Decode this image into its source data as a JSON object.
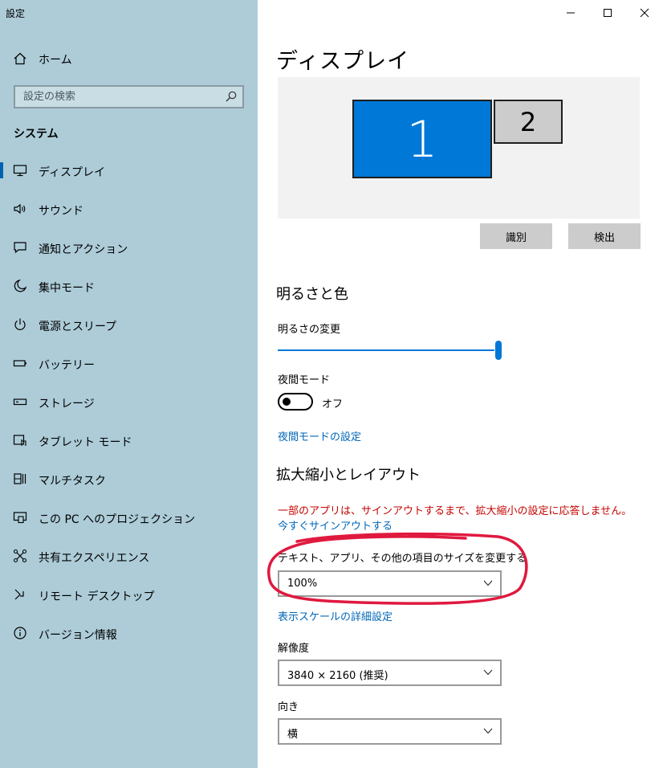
{
  "window": {
    "title": "設定"
  },
  "sidebar": {
    "home_label": "ホーム",
    "search_placeholder": "設定の検索",
    "section_label": "システム",
    "items": [
      {
        "label": "ディスプレイ",
        "icon": "monitor-icon",
        "active": true
      },
      {
        "label": "サウンド",
        "icon": "speaker-icon",
        "active": false
      },
      {
        "label": "通知とアクション",
        "icon": "message-icon",
        "active": false
      },
      {
        "label": "集中モード",
        "icon": "moon-icon",
        "active": false
      },
      {
        "label": "電源とスリープ",
        "icon": "power-icon",
        "active": false
      },
      {
        "label": "バッテリー",
        "icon": "battery-icon",
        "active": false
      },
      {
        "label": "ストレージ",
        "icon": "storage-icon",
        "active": false
      },
      {
        "label": "タブレット モード",
        "icon": "tablet-icon",
        "active": false
      },
      {
        "label": "マルチタスク",
        "icon": "multitask-icon",
        "active": false
      },
      {
        "label": "この PC へのプロジェクション",
        "icon": "projection-icon",
        "active": false
      },
      {
        "label": "共有エクスペリエンス",
        "icon": "shared-icon",
        "active": false
      },
      {
        "label": "リモート デスクトップ",
        "icon": "remote-desktop-icon",
        "active": false
      },
      {
        "label": "バージョン情報",
        "icon": "info-icon",
        "active": false
      }
    ]
  },
  "main": {
    "title": "ディスプレイ",
    "monitors": [
      "1",
      "2"
    ],
    "identify_label": "識別",
    "detect_label": "検出",
    "brightness_section": "明るさと色",
    "brightness_label": "明るさの変更",
    "brightness_value": 100,
    "night_mode_label": "夜間モード",
    "night_mode_state": "オフ",
    "night_mode_settings_link": "夜間モードの設定",
    "scale_section": "拡大縮小とレイアウト",
    "scale_warning": "一部のアプリは、サインアウトするまで、拡大縮小の設定に応答しません。",
    "sign_out_link": "今すぐサインアウトする",
    "text_size_label": "テキスト、アプリ、その他の項目のサイズを変更する",
    "text_size_value": "100%",
    "advanced_scale_link": "表示スケールの詳細設定",
    "resolution_label": "解像度",
    "resolution_value": "3840 × 2160 (推奨)",
    "orientation_label": "向き",
    "orientation_value": "横"
  },
  "colors": {
    "sidebar_bg": "#adccd8",
    "accent": "#0078d7",
    "link": "#0067b8",
    "warning": "#c50500",
    "annotation": "#e0193f"
  }
}
